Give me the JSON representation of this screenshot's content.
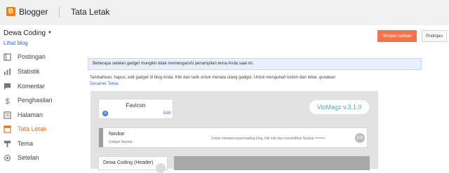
{
  "app": {
    "logo_letter": "B",
    "brand": "Blogger",
    "page_title": "Tata Letak"
  },
  "blog": {
    "name": "Dewa Coding",
    "view_blog": "Lihat blog"
  },
  "sidebar": {
    "items": [
      {
        "label": "Postingan",
        "icon": "posts-icon"
      },
      {
        "label": "Statistik",
        "icon": "stats-icon"
      },
      {
        "label": "Komentar",
        "icon": "comment-icon"
      },
      {
        "label": "Penghasilan",
        "icon": "dollar-icon"
      },
      {
        "label": "Halaman",
        "icon": "pages-icon"
      },
      {
        "label": "Tata Letak",
        "icon": "layout-icon",
        "active": true
      },
      {
        "label": "Tema",
        "icon": "theme-icon"
      },
      {
        "label": "Setelan",
        "icon": "gear-icon"
      }
    ]
  },
  "toolbar": {
    "save_label": "Simpan setelan",
    "preview_label": "Pratinjau"
  },
  "notice": "Beberapa setelan gadget mungkin tidak memengaruhi penampilan tema Anda saat ini.",
  "description": {
    "text": "Tambahkan, hapus, edit gadget di blog Anda. Klik dan tarik untuk menata ulang gadget. Untuk mengubah kolom dan lebar, gunakan",
    "link": "Desainer Tema."
  },
  "layout": {
    "favicon": {
      "title": "Favicon",
      "edit": "Edit"
    },
    "brand_badge": "VioMagz v.3.1.0",
    "navbar": {
      "title": "Navbar",
      "subtitle": "Gadget Navbar",
      "hint": "Untuk mempercepat loading blog, klik edit dan nonaktifkan Navbar ====>",
      "edit": "Edit"
    },
    "header": {
      "title": "Dewa Coding (Header)"
    }
  },
  "colors": {
    "accent": "#f4734a",
    "active_nav": "#e7711b",
    "link": "#3367d6",
    "brand": "#f57d00"
  }
}
